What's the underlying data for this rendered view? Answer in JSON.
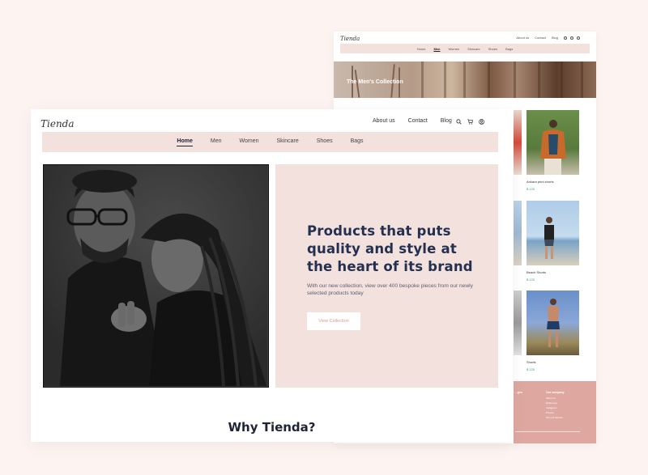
{
  "back_page": {
    "logo": "Tienda",
    "top_links": [
      "About us",
      "Contact",
      "Blog"
    ],
    "nav": [
      "Home",
      "Men",
      "Women",
      "Skincare",
      "Shoes",
      "Bags"
    ],
    "active_nav": "Men",
    "banner_title": "The Men's Collection",
    "products": [
      {
        "name": "Ankara print shorts",
        "price": "$ 120"
      },
      {
        "name": "Beach Shorts",
        "price": "$ 120"
      },
      {
        "name": "Shorts",
        "price": "$ 120"
      }
    ],
    "footer": {
      "heading_left": "...ges",
      "heading_right": "Our company",
      "links": [
        "About us",
        "Reference",
        "Instagram",
        "Privacy",
        "Term of Service"
      ]
    }
  },
  "front_page": {
    "logo": "Tienda",
    "top_links": {
      "about": "About us",
      "contact": "Contact",
      "blog": "Blog"
    },
    "icons": [
      "search-icon",
      "cart-icon",
      "user-icon"
    ],
    "nav": {
      "home": "Home",
      "men": "Men",
      "women": "Women",
      "skincare": "Skincare",
      "shoes": "Shoes",
      "bags": "Bags"
    },
    "hero": {
      "title": "Products that puts quality and style at the heart of its brand",
      "subtitle": "With our new collection, view over 400 bespoke pieces from our newly selected products today",
      "button": "View Collection"
    },
    "section_title": "Why Tienda?"
  },
  "colors": {
    "background": "#fdf3f1",
    "nav_bg": "#f3e1de",
    "hero_title": "#243050",
    "accent": "#d99a8e",
    "footer_bg": "#dea8a0",
    "price": "#3a9a7a"
  }
}
